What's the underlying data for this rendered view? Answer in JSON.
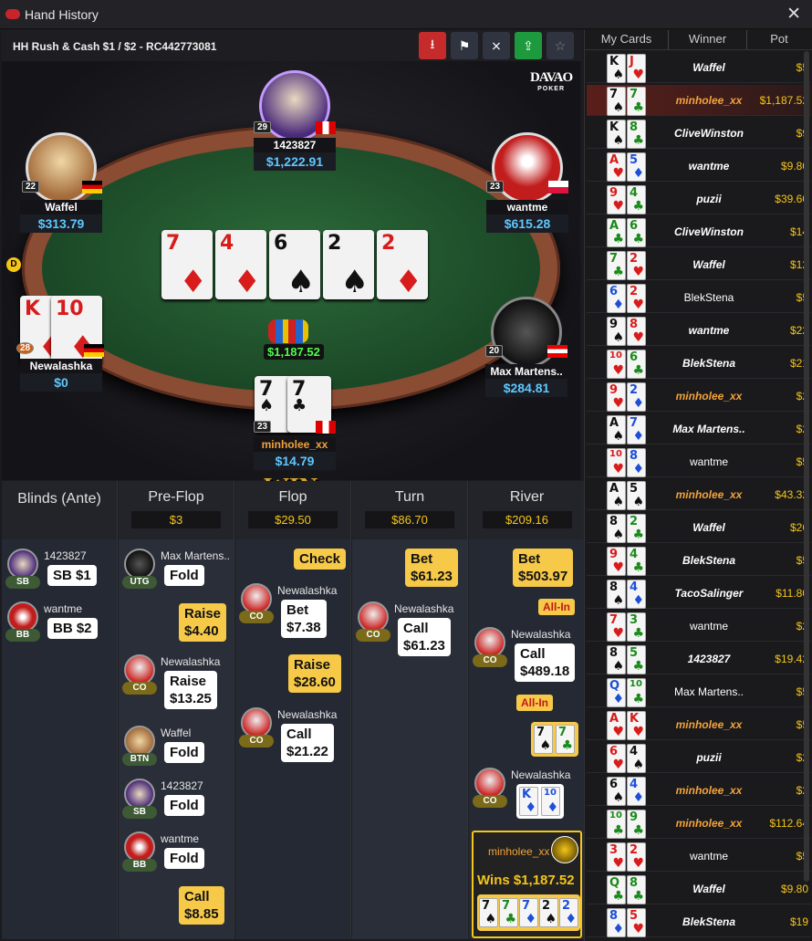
{
  "window": {
    "title": "Hand History",
    "close": "✕"
  },
  "header": {
    "title": "HH  Rush & Cash $1 / $2   - RC442773081"
  },
  "toolbar": {
    "download": "⭳",
    "flag": "⚑",
    "no_replay": "⨯",
    "share": "⇪",
    "star": "☆"
  },
  "brand": {
    "name": "DAVAO",
    "sub": "POKER"
  },
  "seats": [
    {
      "name": "1423827",
      "stack": "$1,222.91",
      "level": "29"
    },
    {
      "name": "Waffel",
      "stack": "$313.79",
      "level": "22"
    },
    {
      "name": "wantme",
      "stack": "$615.28",
      "level": "23"
    },
    {
      "name": "Newalashka",
      "stack": "$0",
      "level": "28"
    },
    {
      "name": "Max Martens..",
      "stack": "$284.81",
      "level": "20"
    },
    {
      "name": "minholee_xx",
      "stack": "$14.79",
      "level": "23"
    }
  ],
  "dealer_label": "D",
  "board": [
    {
      "rank": "7",
      "suit": "♦"
    },
    {
      "rank": "4",
      "suit": "♦"
    },
    {
      "rank": "6",
      "suit": "♠"
    },
    {
      "rank": "2",
      "suit": "♠"
    },
    {
      "rank": "2",
      "suit": "♦"
    }
  ],
  "pot": "$1,187.52",
  "win_label": "WIN",
  "newalashka_cards": [
    {
      "rank": "K",
      "suit": "♦"
    },
    {
      "rank": "10",
      "suit": "♦"
    }
  ],
  "hero_cards": [
    {
      "rank": "7",
      "suit": "♠"
    },
    {
      "rank": "7",
      "suit": "♣"
    }
  ],
  "streets": {
    "blinds": {
      "name": "Blinds (Ante)"
    },
    "preflop": {
      "name": "Pre-Flop",
      "pot": "$3"
    },
    "flop": {
      "name": "Flop",
      "pot": "$29.50"
    },
    "turn": {
      "name": "Turn",
      "pot": "$86.70"
    },
    "river": {
      "name": "River",
      "pot": "$209.16"
    }
  },
  "actions": {
    "blinds": [
      {
        "name": "1423827",
        "pos": "SB",
        "text": "SB  $1"
      },
      {
        "name": "wantme",
        "pos": "BB",
        "text": "BB  $2"
      }
    ],
    "preflop": {
      "a1_name": "Max Martens..",
      "a1_pos": "UTG",
      "a1_text": "Fold",
      "a2_text1": "Raise",
      "a2_text2": "$4.40",
      "a3_name": "Newalashka",
      "a3_pos": "CO",
      "a3_text1": "Raise",
      "a3_text2": "$13.25",
      "a4_name": "Waffel",
      "a4_pos": "BTN",
      "a4_text": "Fold",
      "a5_name": "1423827",
      "a5_pos": "SB",
      "a5_text": "Fold",
      "a6_name": "wantme",
      "a6_pos": "BB",
      "a6_text": "Fold",
      "a7_text1": "Call",
      "a7_text2": "$8.85"
    },
    "flop": {
      "a1_text": "Check",
      "a2_name": "Newalashka",
      "a2_pos": "CO",
      "a2_text1": "Bet",
      "a2_text2": "$7.38",
      "a3_text1": "Raise",
      "a3_text2": "$28.60",
      "a4_name": "Newalashka",
      "a4_pos": "CO",
      "a4_text1": "Call",
      "a4_text2": "$21.22"
    },
    "turn": {
      "a1_text1": "Bet",
      "a1_text2": "$61.23",
      "a2_name": "Newalashka",
      "a2_pos": "CO",
      "a2_text1": "Call",
      "a2_text2": "$61.23"
    },
    "river": {
      "a1_text1": "Bet",
      "a1_text2": "$503.97",
      "a1_allin": "All-In",
      "a2_name": "Newalashka",
      "a2_pos": "CO",
      "a2_text1": "Call",
      "a2_text2": "$489.18",
      "a2_allin": "All-In",
      "a3_name": "Newalashka",
      "a3_pos": "CO",
      "winner_name": "minholee_xx",
      "winner_text": "Wins $1,187.52"
    }
  },
  "sidebar": {
    "headers": [
      "My Cards",
      "Winner",
      "Pot"
    ],
    "rows": [
      {
        "c1": "K",
        "s1": "♠",
        "c2": "J",
        "s2": "♥",
        "winner": "Waffel",
        "pot": "$5",
        "style": "i"
      },
      {
        "c1": "7",
        "s1": "♠",
        "c2": "7",
        "s2": "♣",
        "winner": "minholee_xx",
        "pot": "$1,187.52",
        "style": "o"
      },
      {
        "c1": "K",
        "s1": "♠",
        "c2": "8",
        "s2": "♣",
        "winner": "CliveWinston",
        "pot": "$9",
        "style": "i"
      },
      {
        "c1": "A",
        "s1": "♥",
        "c2": "5",
        "s2": "♦",
        "winner": "wantme",
        "pot": "$9.80",
        "style": "i"
      },
      {
        "c1": "9",
        "s1": "♥",
        "c2": "4",
        "s2": "♣",
        "winner": "puzii",
        "pot": "$39.60",
        "style": "i"
      },
      {
        "c1": "A",
        "s1": "♣",
        "c2": "6",
        "s2": "♣",
        "winner": "CliveWinston",
        "pot": "$14",
        "style": "i"
      },
      {
        "c1": "7",
        "s1": "♣",
        "c2": "2",
        "s2": "♥",
        "winner": "Waffel",
        "pot": "$12",
        "style": "i"
      },
      {
        "c1": "6",
        "s1": "♦",
        "c2": "2",
        "s2": "♥",
        "winner": "BlekStena",
        "pot": "$5",
        "style": "n"
      },
      {
        "c1": "9",
        "s1": "♠",
        "c2": "8",
        "s2": "♥",
        "winner": "wantme",
        "pot": "$22",
        "style": "i"
      },
      {
        "c1": "10",
        "s1": "♥",
        "c2": "6",
        "s2": "♣",
        "winner": "BlekStena",
        "pot": "$21",
        "style": "i"
      },
      {
        "c1": "9",
        "s1": "♥",
        "c2": "2",
        "s2": "♦",
        "winner": "minholee_xx",
        "pot": "$2",
        "style": "o"
      },
      {
        "c1": "A",
        "s1": "♠",
        "c2": "7",
        "s2": "♦",
        "winner": "Max Martens..",
        "pot": "$2",
        "style": "i"
      },
      {
        "c1": "10",
        "s1": "♥",
        "c2": "8",
        "s2": "♦",
        "winner": "wantme",
        "pot": "$5",
        "style": "n"
      },
      {
        "c1": "A",
        "s1": "♠",
        "c2": "5",
        "s2": "♠",
        "winner": "minholee_xx",
        "pot": "$43.32",
        "style": "o"
      },
      {
        "c1": "8",
        "s1": "♠",
        "c2": "2",
        "s2": "♣",
        "winner": "Waffel",
        "pot": "$26",
        "style": "i"
      },
      {
        "c1": "9",
        "s1": "♥",
        "c2": "4",
        "s2": "♣",
        "winner": "BlekStena",
        "pot": "$5",
        "style": "i"
      },
      {
        "c1": "8",
        "s1": "♠",
        "c2": "4",
        "s2": "♦",
        "winner": "TacoSalinger",
        "pot": "$11.80",
        "style": "i"
      },
      {
        "c1": "7",
        "s1": "♥",
        "c2": "3",
        "s2": "♣",
        "winner": "wantme",
        "pot": "$2",
        "style": "n"
      },
      {
        "c1": "8",
        "s1": "♠",
        "c2": "5",
        "s2": "♣",
        "winner": "1423827",
        "pot": "$19.42",
        "style": "i"
      },
      {
        "c1": "Q",
        "s1": "♦",
        "c2": "10",
        "s2": "♣",
        "winner": "Max Martens..",
        "pot": "$5",
        "style": "n"
      },
      {
        "c1": "A",
        "s1": "♥",
        "c2": "K",
        "s2": "♥",
        "winner": "minholee_xx",
        "pot": "$5",
        "style": "o"
      },
      {
        "c1": "6",
        "s1": "♥",
        "c2": "4",
        "s2": "♠",
        "winner": "puzii",
        "pot": "$2",
        "style": "i"
      },
      {
        "c1": "6",
        "s1": "♠",
        "c2": "4",
        "s2": "♦",
        "winner": "minholee_xx",
        "pot": "$2",
        "style": "o"
      },
      {
        "c1": "10",
        "s1": "♣",
        "c2": "9",
        "s2": "♣",
        "winner": "minholee_xx",
        "pot": "$112.64",
        "style": "o"
      },
      {
        "c1": "3",
        "s1": "♥",
        "c2": "2",
        "s2": "♥",
        "winner": "wantme",
        "pot": "$5",
        "style": "n"
      },
      {
        "c1": "Q",
        "s1": "♣",
        "c2": "8",
        "s2": "♣",
        "winner": "Waffel",
        "pot": "$9.80",
        "style": "i"
      },
      {
        "c1": "8",
        "s1": "♦",
        "c2": "5",
        "s2": "♥",
        "winner": "BlekStena",
        "pot": "$19",
        "style": "i"
      }
    ]
  },
  "colors": {
    "accent": "#f5c518",
    "stack": "#5ec8ff",
    "winner_orange": "#f3a23a"
  }
}
